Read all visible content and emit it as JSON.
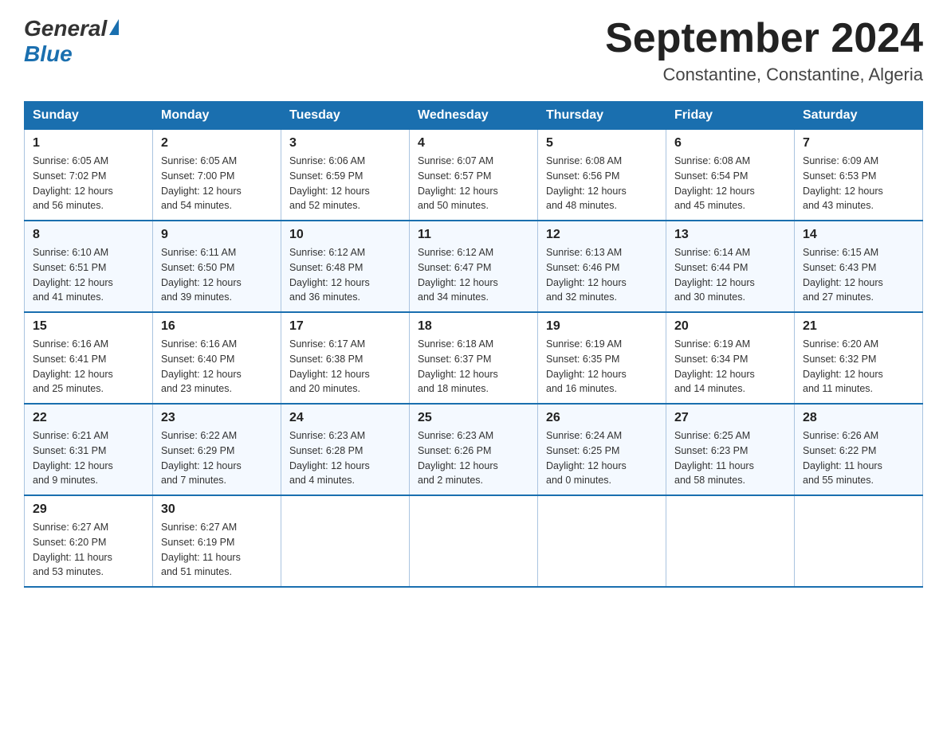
{
  "logo": {
    "general": "General",
    "blue": "Blue"
  },
  "title": "September 2024",
  "location": "Constantine, Constantine, Algeria",
  "weekdays": [
    "Sunday",
    "Monday",
    "Tuesday",
    "Wednesday",
    "Thursday",
    "Friday",
    "Saturday"
  ],
  "weeks": [
    [
      {
        "day": "1",
        "sunrise": "6:05 AM",
        "sunset": "7:02 PM",
        "daylight": "12 hours and 56 minutes."
      },
      {
        "day": "2",
        "sunrise": "6:05 AM",
        "sunset": "7:00 PM",
        "daylight": "12 hours and 54 minutes."
      },
      {
        "day": "3",
        "sunrise": "6:06 AM",
        "sunset": "6:59 PM",
        "daylight": "12 hours and 52 minutes."
      },
      {
        "day": "4",
        "sunrise": "6:07 AM",
        "sunset": "6:57 PM",
        "daylight": "12 hours and 50 minutes."
      },
      {
        "day": "5",
        "sunrise": "6:08 AM",
        "sunset": "6:56 PM",
        "daylight": "12 hours and 48 minutes."
      },
      {
        "day": "6",
        "sunrise": "6:08 AM",
        "sunset": "6:54 PM",
        "daylight": "12 hours and 45 minutes."
      },
      {
        "day": "7",
        "sunrise": "6:09 AM",
        "sunset": "6:53 PM",
        "daylight": "12 hours and 43 minutes."
      }
    ],
    [
      {
        "day": "8",
        "sunrise": "6:10 AM",
        "sunset": "6:51 PM",
        "daylight": "12 hours and 41 minutes."
      },
      {
        "day": "9",
        "sunrise": "6:11 AM",
        "sunset": "6:50 PM",
        "daylight": "12 hours and 39 minutes."
      },
      {
        "day": "10",
        "sunrise": "6:12 AM",
        "sunset": "6:48 PM",
        "daylight": "12 hours and 36 minutes."
      },
      {
        "day": "11",
        "sunrise": "6:12 AM",
        "sunset": "6:47 PM",
        "daylight": "12 hours and 34 minutes."
      },
      {
        "day": "12",
        "sunrise": "6:13 AM",
        "sunset": "6:46 PM",
        "daylight": "12 hours and 32 minutes."
      },
      {
        "day": "13",
        "sunrise": "6:14 AM",
        "sunset": "6:44 PM",
        "daylight": "12 hours and 30 minutes."
      },
      {
        "day": "14",
        "sunrise": "6:15 AM",
        "sunset": "6:43 PM",
        "daylight": "12 hours and 27 minutes."
      }
    ],
    [
      {
        "day": "15",
        "sunrise": "6:16 AM",
        "sunset": "6:41 PM",
        "daylight": "12 hours and 25 minutes."
      },
      {
        "day": "16",
        "sunrise": "6:16 AM",
        "sunset": "6:40 PM",
        "daylight": "12 hours and 23 minutes."
      },
      {
        "day": "17",
        "sunrise": "6:17 AM",
        "sunset": "6:38 PM",
        "daylight": "12 hours and 20 minutes."
      },
      {
        "day": "18",
        "sunrise": "6:18 AM",
        "sunset": "6:37 PM",
        "daylight": "12 hours and 18 minutes."
      },
      {
        "day": "19",
        "sunrise": "6:19 AM",
        "sunset": "6:35 PM",
        "daylight": "12 hours and 16 minutes."
      },
      {
        "day": "20",
        "sunrise": "6:19 AM",
        "sunset": "6:34 PM",
        "daylight": "12 hours and 14 minutes."
      },
      {
        "day": "21",
        "sunrise": "6:20 AM",
        "sunset": "6:32 PM",
        "daylight": "12 hours and 11 minutes."
      }
    ],
    [
      {
        "day": "22",
        "sunrise": "6:21 AM",
        "sunset": "6:31 PM",
        "daylight": "12 hours and 9 minutes."
      },
      {
        "day": "23",
        "sunrise": "6:22 AM",
        "sunset": "6:29 PM",
        "daylight": "12 hours and 7 minutes."
      },
      {
        "day": "24",
        "sunrise": "6:23 AM",
        "sunset": "6:28 PM",
        "daylight": "12 hours and 4 minutes."
      },
      {
        "day": "25",
        "sunrise": "6:23 AM",
        "sunset": "6:26 PM",
        "daylight": "12 hours and 2 minutes."
      },
      {
        "day": "26",
        "sunrise": "6:24 AM",
        "sunset": "6:25 PM",
        "daylight": "12 hours and 0 minutes."
      },
      {
        "day": "27",
        "sunrise": "6:25 AM",
        "sunset": "6:23 PM",
        "daylight": "11 hours and 58 minutes."
      },
      {
        "day": "28",
        "sunrise": "6:26 AM",
        "sunset": "6:22 PM",
        "daylight": "11 hours and 55 minutes."
      }
    ],
    [
      {
        "day": "29",
        "sunrise": "6:27 AM",
        "sunset": "6:20 PM",
        "daylight": "11 hours and 53 minutes."
      },
      {
        "day": "30",
        "sunrise": "6:27 AM",
        "sunset": "6:19 PM",
        "daylight": "11 hours and 51 minutes."
      },
      null,
      null,
      null,
      null,
      null
    ]
  ],
  "labels": {
    "sunrise": "Sunrise:",
    "sunset": "Sunset:",
    "daylight": "Daylight:"
  }
}
